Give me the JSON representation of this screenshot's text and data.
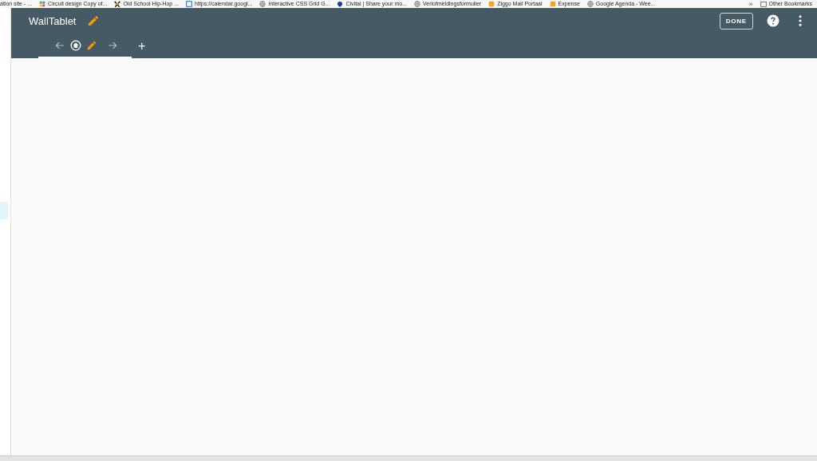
{
  "bookmarks": [
    {
      "label": "ation site - ...",
      "kind": "plain"
    },
    {
      "label": "Circuit design Copy of...",
      "kind": "grid"
    },
    {
      "label": "Old School Hip-Hop ...",
      "kind": "figure"
    },
    {
      "label": "https://calendar.googl...",
      "kind": "calendar"
    },
    {
      "label": "Interactive CSS Grid G...",
      "kind": "globe"
    },
    {
      "label": "Civitai | Share your mo...",
      "kind": "shield"
    },
    {
      "label": "Verlofmeldingsformulier",
      "kind": "globe"
    },
    {
      "label": "Ziggo Mail Portaal",
      "kind": "square"
    },
    {
      "label": "Expense",
      "kind": "square"
    },
    {
      "label": "Google Agenda - Wee...",
      "kind": "globe"
    }
  ],
  "bookmarks_overflow": "»",
  "other_bookmarks": "Other Bookmarks",
  "sidebar": {
    "items": [
      {
        "selected": true
      }
    ]
  },
  "toolbar": {
    "title": "WallTablet",
    "done_button": "DONE"
  },
  "views": [
    {
      "kind": "home",
      "selected": true
    }
  ],
  "add_view": "+"
}
